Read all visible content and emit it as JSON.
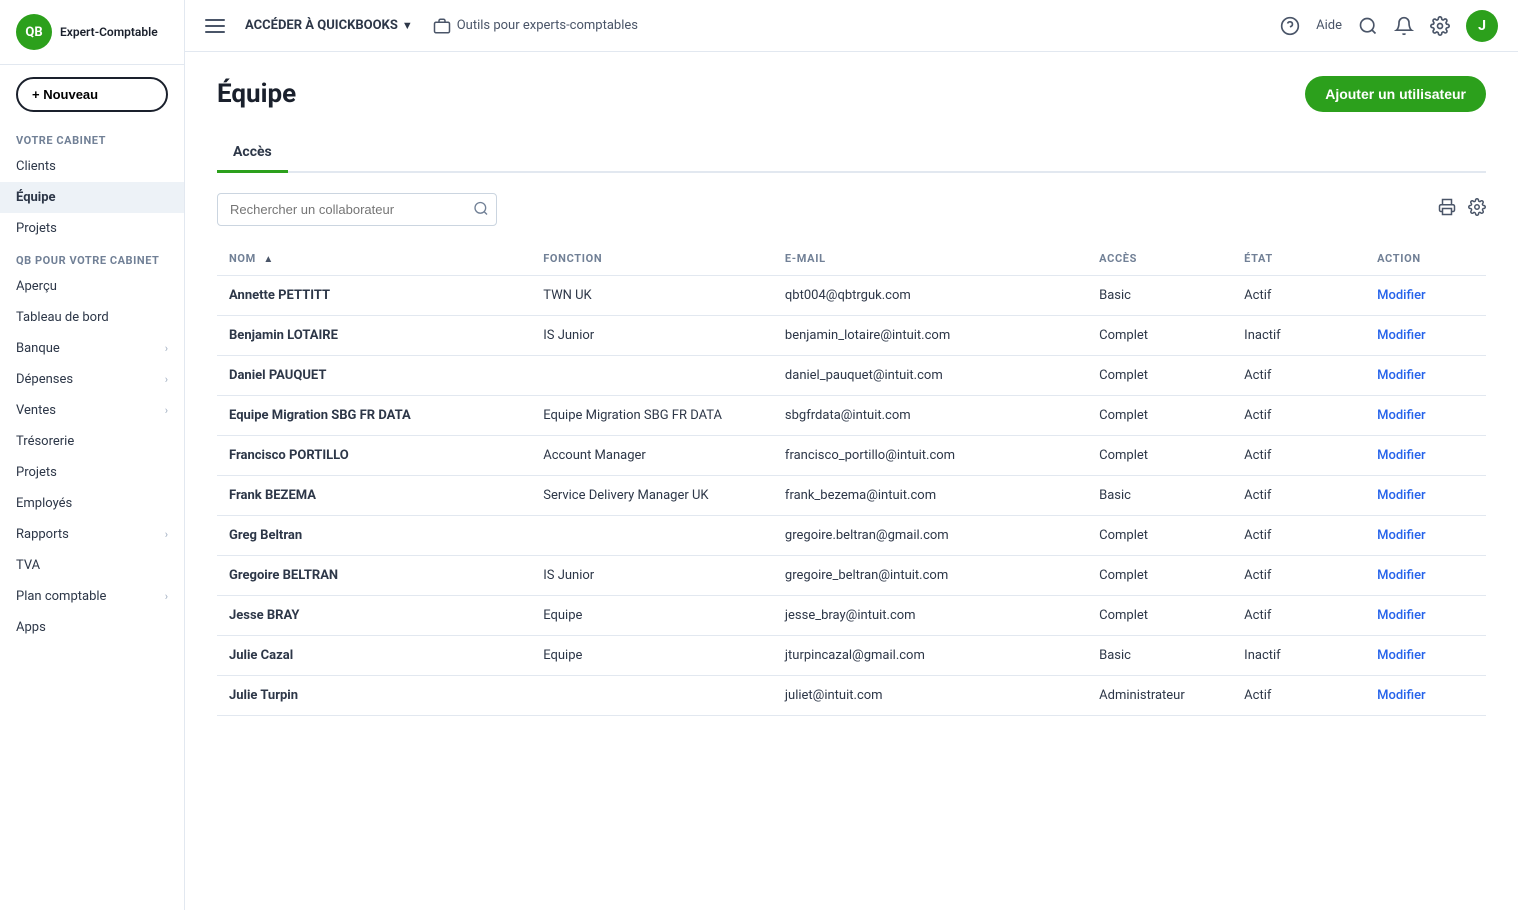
{
  "sidebar": {
    "logo_text": "Expert-Comptable",
    "new_button_label": "+ Nouveau",
    "section_votre_cabinet": "VOTRE CABINET",
    "section_qb": "QB POUR VOTRE CABINET",
    "votre_cabinet_items": [
      {
        "id": "clients",
        "label": "Clients",
        "active": false,
        "has_chevron": false
      },
      {
        "id": "equipe",
        "label": "Équipe",
        "active": true,
        "has_chevron": false
      },
      {
        "id": "projets",
        "label": "Projets",
        "active": false,
        "has_chevron": false
      }
    ],
    "qb_items": [
      {
        "id": "apercu",
        "label": "Aperçu",
        "active": false,
        "has_chevron": false
      },
      {
        "id": "tableau-de-bord",
        "label": "Tableau de bord",
        "active": false,
        "has_chevron": false
      },
      {
        "id": "banque",
        "label": "Banque",
        "active": false,
        "has_chevron": true
      },
      {
        "id": "depenses",
        "label": "Dépenses",
        "active": false,
        "has_chevron": true
      },
      {
        "id": "ventes",
        "label": "Ventes",
        "active": false,
        "has_chevron": true
      },
      {
        "id": "tresorerie",
        "label": "Trésorerie",
        "active": false,
        "has_chevron": false
      },
      {
        "id": "projets2",
        "label": "Projets",
        "active": false,
        "has_chevron": false
      },
      {
        "id": "employes",
        "label": "Employés",
        "active": false,
        "has_chevron": false
      },
      {
        "id": "rapports",
        "label": "Rapports",
        "active": false,
        "has_chevron": true
      },
      {
        "id": "tva",
        "label": "TVA",
        "active": false,
        "has_chevron": false
      },
      {
        "id": "plan-comptable",
        "label": "Plan comptable",
        "active": false,
        "has_chevron": true
      },
      {
        "id": "apps",
        "label": "Apps",
        "active": false,
        "has_chevron": false
      }
    ]
  },
  "topnav": {
    "brand_label": "ACCÉDER À QUICKBOOKS",
    "tools_label": "Outils pour experts-comptables",
    "aide_label": "Aide",
    "user_initial": "J"
  },
  "page": {
    "title": "Équipe",
    "add_user_button": "Ajouter un utilisateur"
  },
  "tabs": [
    {
      "id": "acces",
      "label": "Accès",
      "active": true
    }
  ],
  "search": {
    "placeholder": "Rechercher un collaborateur"
  },
  "table": {
    "columns": [
      {
        "id": "nom",
        "label": "NOM",
        "sortable": true
      },
      {
        "id": "fonction",
        "label": "FONCTION",
        "sortable": false
      },
      {
        "id": "email",
        "label": "E-MAIL",
        "sortable": false
      },
      {
        "id": "acces",
        "label": "ACCÈS",
        "sortable": false
      },
      {
        "id": "etat",
        "label": "ÉTAT",
        "sortable": false
      },
      {
        "id": "action",
        "label": "ACTION",
        "sortable": false
      }
    ],
    "rows": [
      {
        "nom": "Annette PETTITT",
        "fonction": "TWN UK",
        "email": "qbt004@qbtrguk.com",
        "acces": "Basic",
        "etat": "Actif",
        "action": "Modifier"
      },
      {
        "nom": "Benjamin LOTAIRE",
        "fonction": "IS Junior",
        "email": "benjamin_lotaire@intuit.com",
        "acces": "Complet",
        "etat": "Inactif",
        "action": "Modifier"
      },
      {
        "nom": "Daniel PAUQUET",
        "fonction": "",
        "email": "daniel_pauquet@intuit.com",
        "acces": "Complet",
        "etat": "Actif",
        "action": "Modifier"
      },
      {
        "nom": "Equipe Migration SBG FR DATA",
        "fonction": "Equipe Migration SBG FR DATA",
        "email": "sbgfrdata@intuit.com",
        "acces": "Complet",
        "etat": "Actif",
        "action": "Modifier"
      },
      {
        "nom": "Francisco PORTILLO",
        "fonction": "Account Manager",
        "email": "francisco_portillo@intuit.com",
        "acces": "Complet",
        "etat": "Actif",
        "action": "Modifier"
      },
      {
        "nom": "Frank BEZEMA",
        "fonction": "Service Delivery Manager UK",
        "email": "frank_bezema@intuit.com",
        "acces": "Basic",
        "etat": "Actif",
        "action": "Modifier"
      },
      {
        "nom": "Greg Beltran",
        "fonction": "",
        "email": "gregoire.beltran@gmail.com",
        "acces": "Complet",
        "etat": "Actif",
        "action": "Modifier"
      },
      {
        "nom": "Gregoire BELTRAN",
        "fonction": "IS Junior",
        "email": "gregoire_beltran@intuit.com",
        "acces": "Complet",
        "etat": "Actif",
        "action": "Modifier"
      },
      {
        "nom": "Jesse BRAY",
        "fonction": "Equipe",
        "email": "jesse_bray@intuit.com",
        "acces": "Complet",
        "etat": "Actif",
        "action": "Modifier"
      },
      {
        "nom": "Julie Cazal",
        "fonction": "Equipe",
        "email": "jturpincazal@gmail.com",
        "acces": "Basic",
        "etat": "Inactif",
        "action": "Modifier"
      },
      {
        "nom": "Julie Turpin",
        "fonction": "",
        "email": "juliet@intuit.com",
        "acces": "Administrateur",
        "etat": "Actif",
        "action": "Modifier"
      }
    ]
  }
}
